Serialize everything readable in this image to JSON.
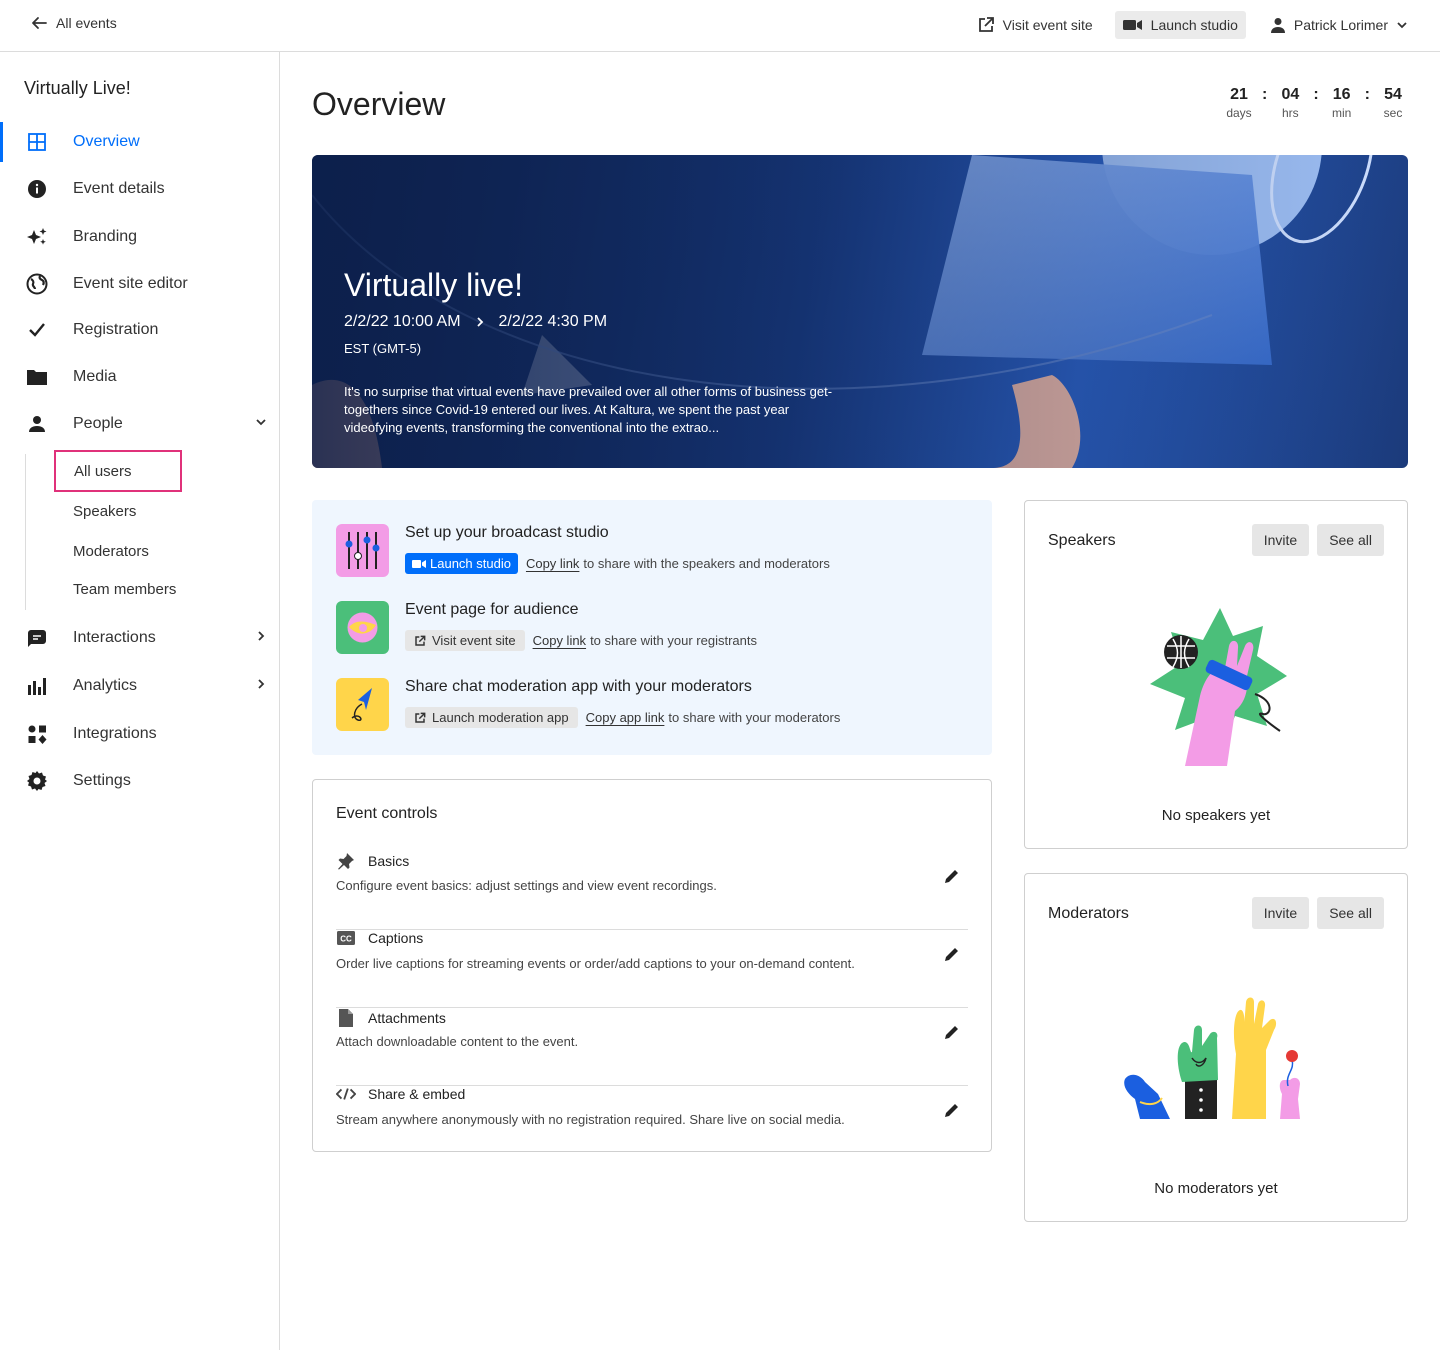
{
  "topbar": {
    "back_label": "All events",
    "visit_site_label": "Visit event site",
    "launch_studio_label": "Launch studio",
    "user_name": "Patrick Lorimer"
  },
  "sidebar": {
    "title": "Virtually Live!",
    "items": [
      {
        "label": "Overview",
        "icon": "grid-icon"
      },
      {
        "label": "Event details",
        "icon": "info-icon"
      },
      {
        "label": "Branding",
        "icon": "sparkle-icon"
      },
      {
        "label": "Event site editor",
        "icon": "globe-icon"
      },
      {
        "label": "Registration",
        "icon": "check-icon"
      },
      {
        "label": "Media",
        "icon": "folder-icon"
      },
      {
        "label": "People",
        "icon": "person-icon"
      },
      {
        "label": "Interactions",
        "icon": "chat-icon"
      },
      {
        "label": "Analytics",
        "icon": "bar-chart-icon"
      },
      {
        "label": "Integrations",
        "icon": "apps-icon"
      },
      {
        "label": "Settings",
        "icon": "gear-icon"
      }
    ],
    "people_sub": [
      "All users",
      "Speakers",
      "Moderators",
      "Team members"
    ]
  },
  "main": {
    "title": "Overview",
    "countdown": {
      "days": "21",
      "hrs": "04",
      "min": "16",
      "sec": "54",
      "days_label": "days",
      "hrs_label": "hrs",
      "min_label": "min",
      "sec_label": "sec",
      "sep": ":"
    },
    "hero": {
      "title": "Virtually live!",
      "start": "2/2/22 10:00 AM",
      "end": "2/2/22 4:30 PM",
      "timezone": "EST (GMT-5)",
      "description": "It's no surprise that virtual events have prevailed over all other forms of business get-togethers since Covid-19 entered our lives. At Kaltura, we spent the past year videofying events, transforming the conventional into the extrao..."
    },
    "quick": {
      "studio": {
        "title": "Set up your broadcast studio",
        "button": "Launch studio",
        "link": "Copy link",
        "suffix": "to share with the speakers and moderators"
      },
      "audience": {
        "title": "Event page for audience",
        "button": "Visit event site",
        "link": "Copy link",
        "suffix": "to share with your registrants"
      },
      "moderation": {
        "title": "Share chat moderation app with your moderators",
        "button": "Launch moderation app",
        "link": "Copy app link",
        "suffix": "to share with your moderators"
      }
    },
    "controls": {
      "title": "Event controls",
      "rows": [
        {
          "title": "Basics",
          "desc": "Configure event basics: adjust settings and view event recordings.",
          "icon": "pin-icon"
        },
        {
          "title": "Captions",
          "desc": "Order live captions for streaming events or order/add captions to your on-demand content.",
          "icon": "cc-icon"
        },
        {
          "title": "Attachments",
          "desc": "Attach downloadable content to the event.",
          "icon": "file-icon"
        },
        {
          "title": "Share & embed",
          "desc": "Stream anywhere anonymously with no registration required. Share live on social media.",
          "icon": "code-icon"
        }
      ]
    },
    "speakers": {
      "title": "Speakers",
      "invite": "Invite",
      "see_all": "See all",
      "empty": "No speakers yet"
    },
    "moderators": {
      "title": "Moderators",
      "invite": "Invite",
      "see_all": "See all",
      "empty": "No moderators yet"
    }
  },
  "colors": {
    "accent": "#006efa",
    "highlight": "#e0317a",
    "quick_bg": "#eff6fe"
  }
}
